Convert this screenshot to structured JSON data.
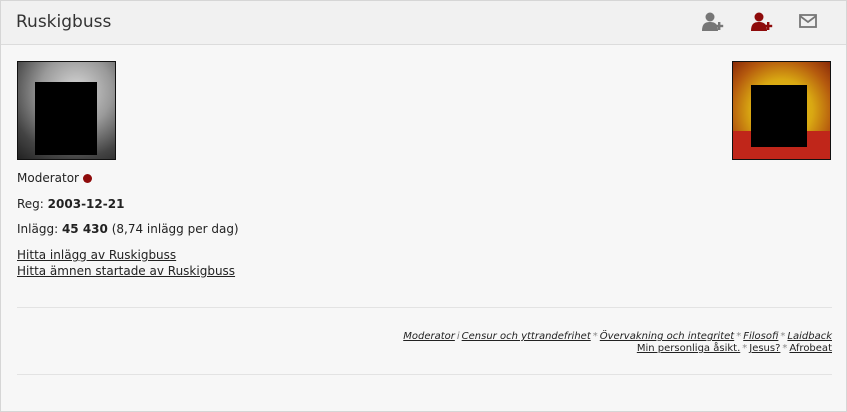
{
  "header": {
    "title": "Ruskigbuss",
    "icons": [
      "add-friend-icon",
      "add-friend-highlighted-icon",
      "envelope-icon"
    ]
  },
  "profile": {
    "role": "Moderator",
    "role_color": "#8e0b0b",
    "reg_label": "Reg:",
    "reg_date": "2003-12-21",
    "posts_label": "Inlägg:",
    "posts_count": "45 430",
    "posts_rate": "(8,74 inlägg per dag)",
    "link_posts": "Hitta inlägg av Ruskigbuss",
    "link_topics": "Hitta ämnen startade av Ruskigbuss"
  },
  "signature": {
    "line1": [
      {
        "text": "Moderator"
      },
      {
        "sep": "i"
      },
      {
        "text": "Censur och yttrandefrihet"
      },
      {
        "sep": "*"
      },
      {
        "text": "Övervakning och integritet"
      },
      {
        "sep": "*"
      },
      {
        "text": "Filosofi"
      },
      {
        "sep": "*"
      },
      {
        "text": "Laidback"
      }
    ],
    "line2": [
      {
        "text": "Min personliga åsikt."
      },
      {
        "sep": "*"
      },
      {
        "text": "Jesus?"
      },
      {
        "sep": "*"
      },
      {
        "text": "Afrobeat"
      }
    ]
  },
  "colors": {
    "accent_red": "#8e0b0b",
    "icon_gray": "#777777"
  }
}
